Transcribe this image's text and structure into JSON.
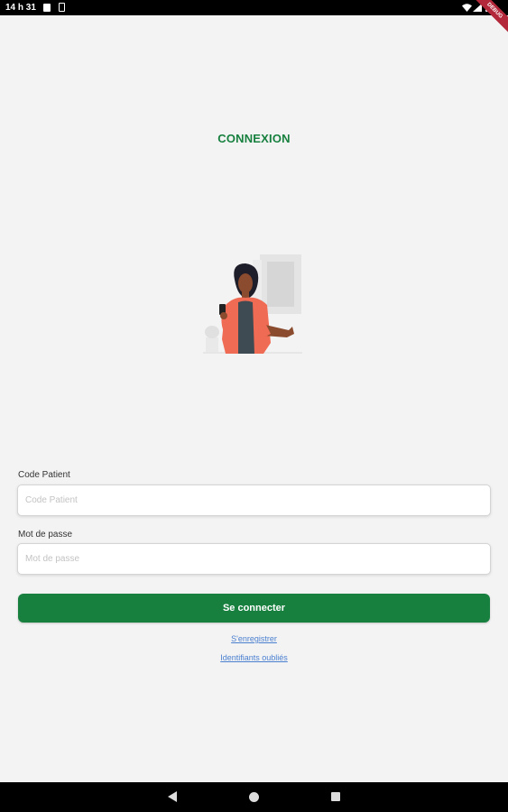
{
  "status_bar": {
    "time": "14 h 31",
    "debug_badge": "DEBUG"
  },
  "page": {
    "title": "CONNEXION"
  },
  "form": {
    "code_label": "Code Patient",
    "code_placeholder": "Code Patient",
    "password_label": "Mot de passe",
    "password_placeholder": "Mot de passe",
    "submit_label": "Se connecter"
  },
  "links": {
    "register": "S'enregistrer",
    "forgot": "Identifiants oubliés"
  },
  "colors": {
    "primary": "#17803f",
    "link": "#4a7fd0",
    "background": "#f3f3f3"
  },
  "icons": {
    "back": "back-triangle-icon",
    "home": "home-circle-icon",
    "recents": "recents-square-icon"
  }
}
